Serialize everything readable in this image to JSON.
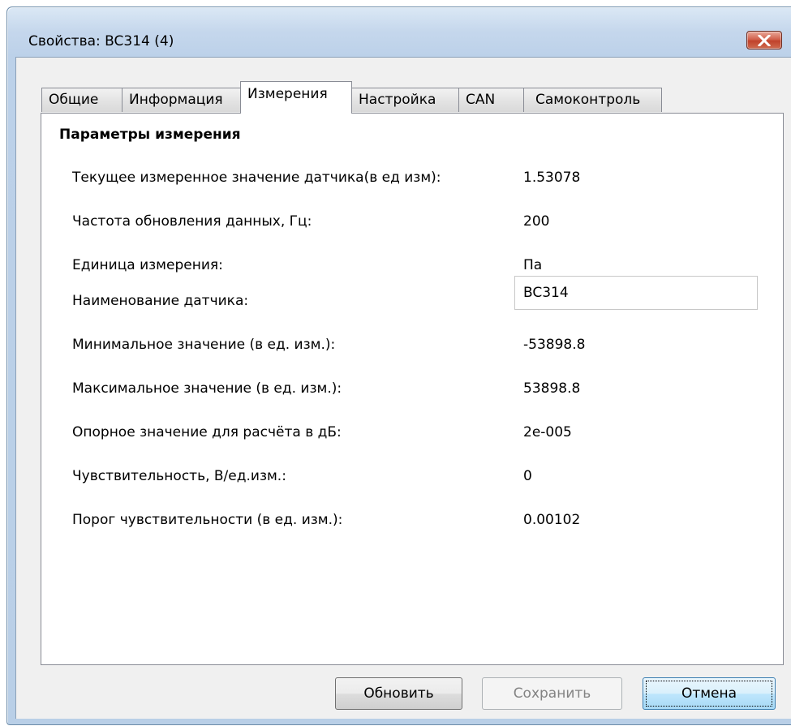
{
  "window": {
    "title": "Свойства: BC314 (4)"
  },
  "tabs": [
    {
      "label": "Общие"
    },
    {
      "label": "Информация"
    },
    {
      "label": "Измерения"
    },
    {
      "label": "Настройка"
    },
    {
      "label": "CAN"
    },
    {
      "label": "Самоконтроль"
    }
  ],
  "active_tab": "Измерения",
  "section": {
    "title": "Параметры измерения"
  },
  "params": [
    {
      "label": "Текущее измеренное значение датчика(в ед изм):",
      "value": "1.53078"
    },
    {
      "label": "Частота обновления данных, Гц:",
      "value": "200"
    },
    {
      "label": "Единица измерения:",
      "value": "Па"
    },
    {
      "label": "Наименование датчика:",
      "value": "BC314"
    },
    {
      "label": "Минимальное значение (в ед. изм.):",
      "value": "-53898.8"
    },
    {
      "label": "Максимальное значение (в ед. изм.):",
      "value": "53898.8"
    },
    {
      "label": "Опорное значение для расчёта в дБ:",
      "value": "2e-005"
    },
    {
      "label": "Чувствительность, В/ед.изм.:",
      "value": "0"
    },
    {
      "label": "Порог чувствительности (в ед. изм.):",
      "value": "0.00102"
    }
  ],
  "buttons": {
    "refresh": "Обновить",
    "save": "Сохранить",
    "cancel": "Отмена"
  },
  "colors": {
    "close_button": "#c9452d",
    "title_bar": "#c5d7ec",
    "default_button_border": "#3c7fb1"
  }
}
